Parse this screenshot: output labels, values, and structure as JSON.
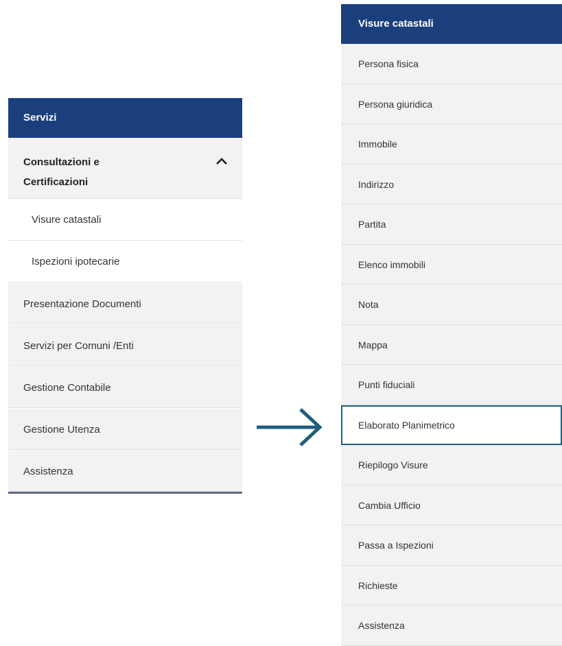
{
  "left_menu": {
    "header": "Servizi",
    "group": {
      "label_line1": "Consultazioni e",
      "label_line2": "Certificazioni",
      "icon": "chevron-up-icon"
    },
    "sub_items": [
      {
        "label": "Visure catastali"
      },
      {
        "label": "Ispezioni ipotecarie"
      }
    ],
    "items": [
      {
        "label": "Presentazione Documenti"
      },
      {
        "label": "Servizi per Comuni /Enti"
      },
      {
        "label": "Gestione Contabile"
      },
      {
        "label": "Gestione Utenza"
      },
      {
        "label": "Assistenza"
      }
    ]
  },
  "arrow": {
    "icon": "arrow-right-icon",
    "color": "#1f5f7a"
  },
  "right_menu": {
    "header": "Visure catastali",
    "selected_item": "Elaborato Planimetrico",
    "items": [
      {
        "label": "Persona fisica"
      },
      {
        "label": "Persona giuridica"
      },
      {
        "label": "Immobile"
      },
      {
        "label": "Indirizzo"
      },
      {
        "label": "Partita"
      },
      {
        "label": "Elenco immobili"
      },
      {
        "label": "Nota"
      },
      {
        "label": "Mappa"
      },
      {
        "label": "Punti fiduciali"
      },
      {
        "label": "Elaborato Planimetrico"
      },
      {
        "label": "Riepilogo Visure"
      },
      {
        "label": "Cambia Ufficio"
      },
      {
        "label": "Passa a Ispezioni"
      },
      {
        "label": "Richieste"
      },
      {
        "label": "Assistenza"
      }
    ]
  },
  "colors": {
    "header_bg": "#1b3f7c",
    "item_bg": "#f2f2f2",
    "accent": "#1f5f7a"
  }
}
